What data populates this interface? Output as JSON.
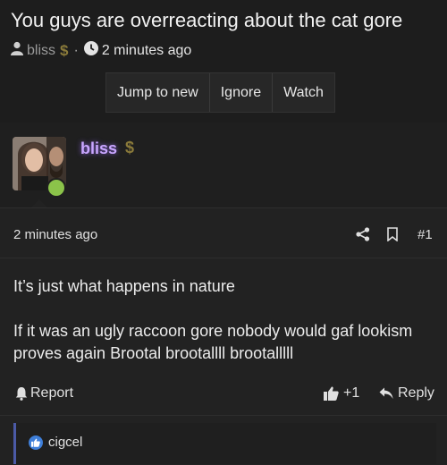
{
  "thread": {
    "title": "You guys are overreacting about the cat gore",
    "author": "bliss",
    "author_badge": "$",
    "separator": "·",
    "time": "2 minutes ago"
  },
  "actions": {
    "jump_to_new": "Jump to new",
    "ignore": "Ignore",
    "watch": "Watch"
  },
  "post": {
    "username": "bliss",
    "badge": "$",
    "time": "2 minutes ago",
    "number": "#1",
    "paragraph1": "It’s just what happens in nature",
    "paragraph2": "If it was an ugly raccoon gore nobody would gaf lookism proves again Brootal brootallll brootalllll",
    "report": "Report",
    "like_count": "+1",
    "reply": "Reply"
  },
  "reactions": {
    "user": "cigcel"
  },
  "colors": {
    "online": "#8bc34a",
    "username": "#c9a6ff",
    "like_blue": "#3f7fd9",
    "reaction_border": "#4b5aa6"
  }
}
